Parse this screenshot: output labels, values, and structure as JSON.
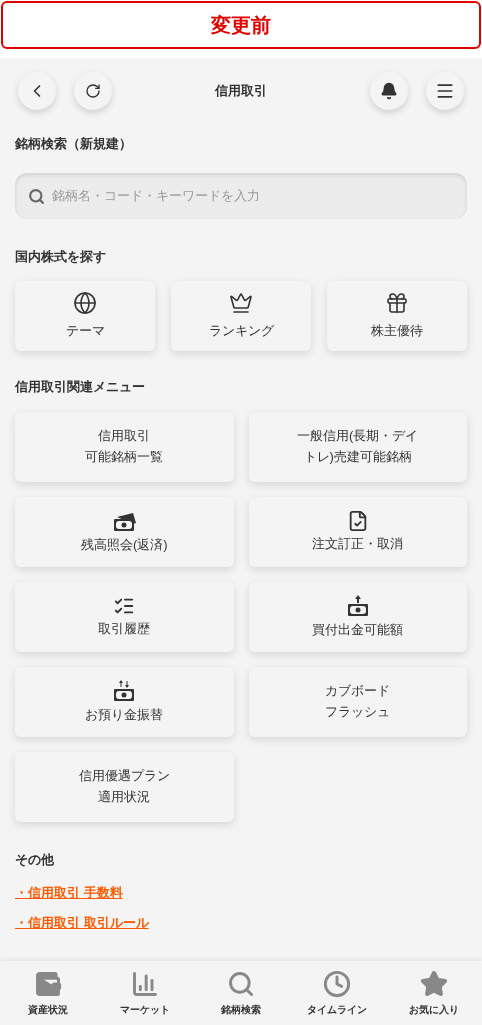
{
  "banner": {
    "label": "変更前"
  },
  "header": {
    "title": "信用取引"
  },
  "search_section": {
    "title": "銘柄検索（新規建）",
    "placeholder": "銘柄名・コード・キーワードを入力"
  },
  "explore_section": {
    "title": "国内株式を探す",
    "items": [
      {
        "label": "テーマ"
      },
      {
        "label": "ランキング"
      },
      {
        "label": "株主優待"
      }
    ]
  },
  "menu_section": {
    "title": "信用取引関連メニュー",
    "items": [
      {
        "kind": "plain",
        "lines": [
          "信用取引",
          "可能銘柄一覧"
        ]
      },
      {
        "kind": "icon",
        "lines": [
          "残高照会(返済)"
        ]
      },
      {
        "kind": "icon",
        "lines": [
          "取引履歴"
        ]
      },
      {
        "kind": "icon",
        "lines": [
          "お預り金振替"
        ]
      },
      {
        "kind": "plain",
        "lines": [
          "信用優遇プラン",
          "適用状況"
        ]
      },
      {
        "kind": "plain",
        "lines": [
          "一般信用(長期・デイ",
          "トレ)売建可能銘柄"
        ]
      },
      {
        "kind": "icon",
        "lines": [
          "注文訂正・取消"
        ]
      },
      {
        "kind": "icon",
        "lines": [
          "買付出金可能額"
        ]
      },
      {
        "kind": "plain",
        "lines": [
          "カブボード",
          "フラッシュ"
        ]
      }
    ]
  },
  "other_section": {
    "title": "その他",
    "links": [
      "・信用取引 手数料",
      "・信用取引 取引ルール"
    ]
  },
  "bottom_nav": [
    {
      "label": "資産状況"
    },
    {
      "label": "マーケット"
    },
    {
      "label": "銘柄検索"
    },
    {
      "label": "タイムライン"
    },
    {
      "label": "お気に入り"
    }
  ]
}
